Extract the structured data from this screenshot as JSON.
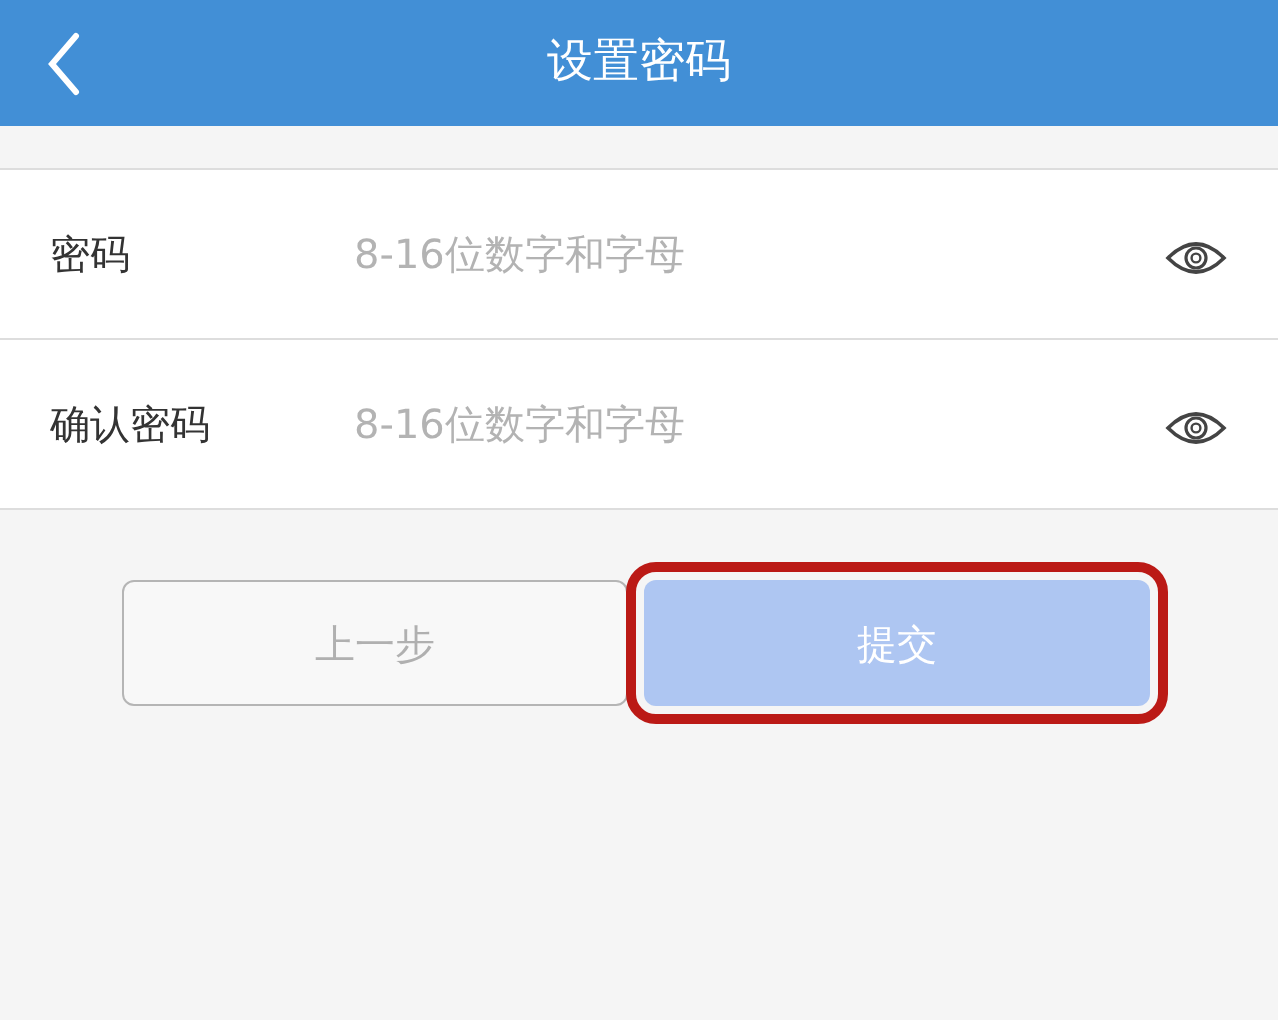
{
  "header": {
    "title": "设置密码"
  },
  "fields": [
    {
      "label": "密码",
      "placeholder": "8-16位数字和字母",
      "revealed": false
    },
    {
      "label": "确认密码",
      "placeholder": "8-16位数字和字母",
      "revealed": false
    }
  ],
  "buttons": [
    {
      "label": "上一步",
      "kind": "outline",
      "disabled": true,
      "highlighted": false
    },
    {
      "label": "提交",
      "kind": "primary",
      "disabled": true,
      "highlighted": true
    }
  ]
}
